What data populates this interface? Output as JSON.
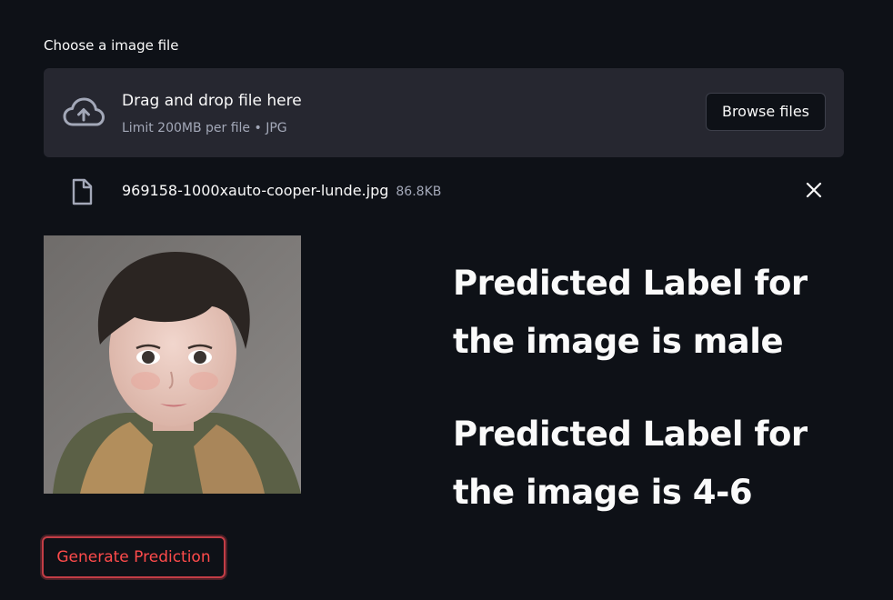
{
  "uploader": {
    "label": "Choose a image file",
    "drop_title": "Drag and drop file here",
    "drop_limit": "Limit 200MB per file • JPG",
    "browse_label": "Browse files",
    "icon": "cloud-upload-icon"
  },
  "file": {
    "name": "969158-1000xauto-cooper-lunde.jpg",
    "size": "86.8KB",
    "icon": "file-icon",
    "remove_icon": "close-icon"
  },
  "results": {
    "gender": "Predicted Label for the image is male",
    "age": "Predicted Label for the image is 4-6"
  },
  "actions": {
    "predict_label": "Generate Prediction"
  },
  "colors": {
    "background": "#0e1117",
    "panel": "#262730",
    "accent": "#ff4b4b"
  }
}
